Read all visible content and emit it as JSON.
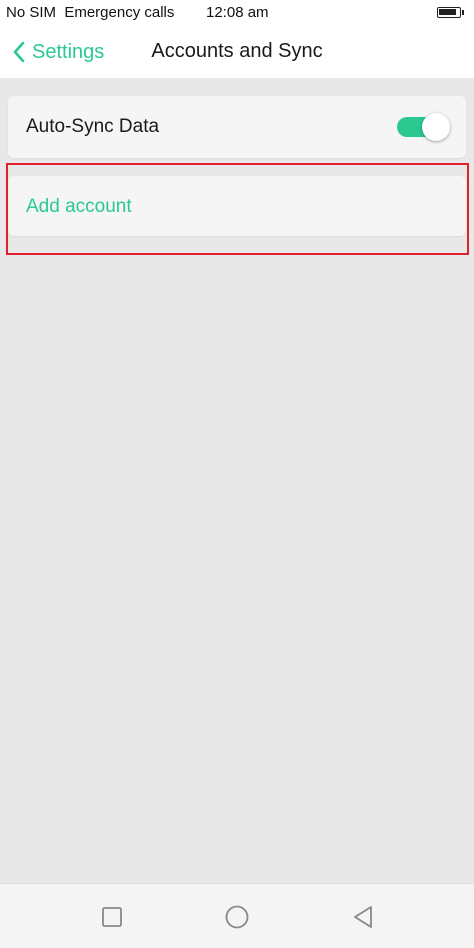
{
  "status_bar": {
    "carrier": "No SIM  Emergency calls",
    "time": "12:08 am"
  },
  "header": {
    "back_label": "Settings",
    "title": "Accounts and Sync"
  },
  "settings": {
    "auto_sync_label": "Auto-Sync Data",
    "auto_sync_enabled": true,
    "add_account_label": "Add account"
  },
  "colors": {
    "accent": "#2bc98f",
    "highlight": "#e0202a",
    "background": "#e8e8e8"
  },
  "icons": {
    "back": "chevron-left-icon",
    "battery": "battery-icon",
    "nav_recent": "square-icon",
    "nav_home": "circle-icon",
    "nav_back": "triangle-back-icon"
  }
}
